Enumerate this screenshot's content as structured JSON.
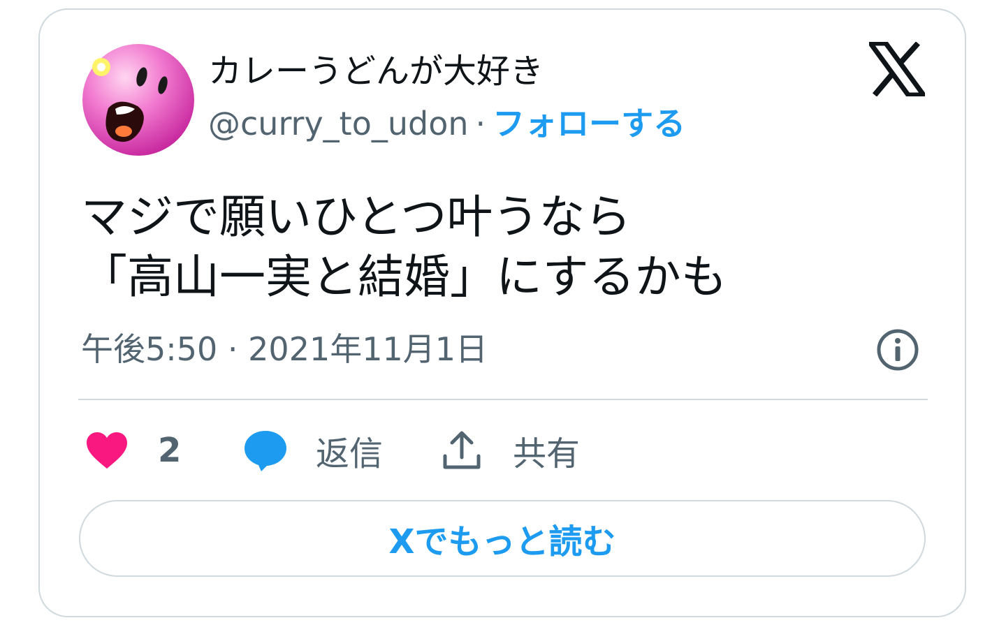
{
  "author": {
    "display_name": "カレーうどんが大好き",
    "handle": "@curry_to_udon",
    "separator": "·",
    "follow_label": "フォローする"
  },
  "tweet": {
    "lines": [
      "マジで願いひとつ叶うなら",
      "「高山一実と結婚」にするかも"
    ],
    "timestamp": "午後5:50 · 2021年11月1日"
  },
  "actions": {
    "like_count": "2",
    "reply_label": "返信",
    "share_label": "共有"
  },
  "read_more_label": "Xでもっと読む",
  "icons": {
    "logo": "x-logo-icon",
    "info": "info-icon",
    "like": "heart-icon",
    "reply": "speech-bubble-icon",
    "share": "share-upload-icon"
  },
  "colors": {
    "text": "#0f1419",
    "secondary": "#536471",
    "accent": "#1d9bf0",
    "heart": "#f91880",
    "border": "#cfd9de"
  }
}
